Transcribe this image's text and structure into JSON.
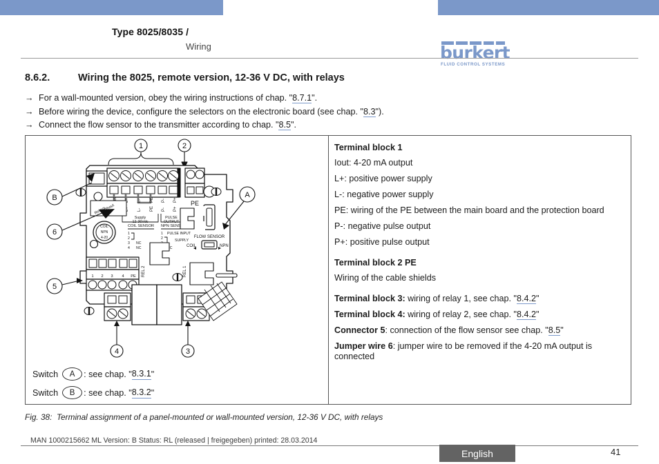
{
  "header": {
    "title": "Type 8025/8035 /",
    "subtitle": "Wiring",
    "logo_word": "burkert",
    "logo_tagline": "FLUID CONTROL SYSTEMS",
    "accent_color": "#7b98c9"
  },
  "section": {
    "number": "8.6.2.",
    "title": "Wiring the 8025, remote version, 12-36 V DC, with relays",
    "bullets": [
      {
        "pre": "For a wall-mounted version, obey the wiring instructions of chap. \"",
        "ref": "8.7.1",
        "post": "\"."
      },
      {
        "pre": "Before wiring the device, configure the selectors on the electronic board (see chap. \"",
        "ref": "8.3",
        "post": "\")."
      },
      {
        "pre": "Connect the flow sensor to the transmitter according to chap. \"",
        "ref": "8.5",
        "post": "\"."
      }
    ]
  },
  "legend": {
    "block1_title": "Terminal block 1",
    "block1_items": [
      "Iout: 4-20 mA output",
      "L+: positive power supply",
      "L-: negative power supply",
      "PE: wiring of the PE between the main board and the protection board",
      "P-: negative pulse output",
      "P+: positive pulse output"
    ],
    "block2_title": "Terminal block 2 PE",
    "block2_text": "Wiring of the cable shields",
    "entries": [
      {
        "label": "Terminal block 3:",
        "text": " wiring of relay 1, see chap. \"",
        "ref": "8.4.2",
        "post": "\""
      },
      {
        "label": "Terminal block 4:",
        "text": " wiring of relay 2, see chap. \"",
        "ref": "8.4.2",
        "post": "\""
      },
      {
        "label": "Connector 5",
        "text": ": connection of the flow sensor see chap. \"",
        "ref": "8.5",
        "post": "\""
      },
      {
        "label": "Jumper wire 6",
        "text": ": jumper wire to be removed if the 4-20 mA output is connected",
        "ref": "",
        "post": ""
      }
    ]
  },
  "diagram": {
    "callouts": [
      "1",
      "2",
      "3",
      "4",
      "5",
      "6",
      "A",
      "B"
    ],
    "terminal_labels": [
      "Iout",
      "L+",
      "L-",
      "PE",
      "P-",
      "P+"
    ],
    "pe_label": "PE",
    "supply_label_1": "Supply",
    "supply_label_2": "12-36Vdc",
    "pulse_label_1": "PULSE",
    "pulse_label_2": "OUTPUT",
    "relay_note_1": "Relays",
    "relay_note_2": "Without",
    "coil_sensor": "COIL SENSOR",
    "npn_sensor": "NPN SENSOR",
    "pulse_input": "PULSE INPUT",
    "supply_text": "SUPPLY",
    "nc_text": "NC",
    "flow_sensor": "FLOW SENSOR",
    "coil": "COIL",
    "npn": "NPN",
    "rel1": "REL 1",
    "rel2": "REL 2",
    "relay_terminals": [
      "1",
      "2",
      "3",
      "4",
      "PE"
    ],
    "sensor_pins": [
      "1",
      "2",
      "3",
      "4"
    ],
    "switch_rows": [
      {
        "prefix": "Switch",
        "marker": "A",
        "suffix_pre": ": see chap. \"",
        "ref": "8.3.1",
        "suffix_post": "\""
      },
      {
        "prefix": "Switch",
        "marker": "B",
        "suffix_pre": ": see chap. \"",
        "ref": "8.3.2",
        "suffix_post": "\""
      }
    ]
  },
  "caption": {
    "id": "Fig. 38:",
    "text": "Terminal assignment of a panel-mounted or wall-mounted version, 12-36 V DC, with relays"
  },
  "footer": {
    "meta": "MAN  1000215662  ML  Version: B Status: RL (released | freigegeben)  printed: 28.03.2014",
    "language": "English",
    "page": "41"
  }
}
